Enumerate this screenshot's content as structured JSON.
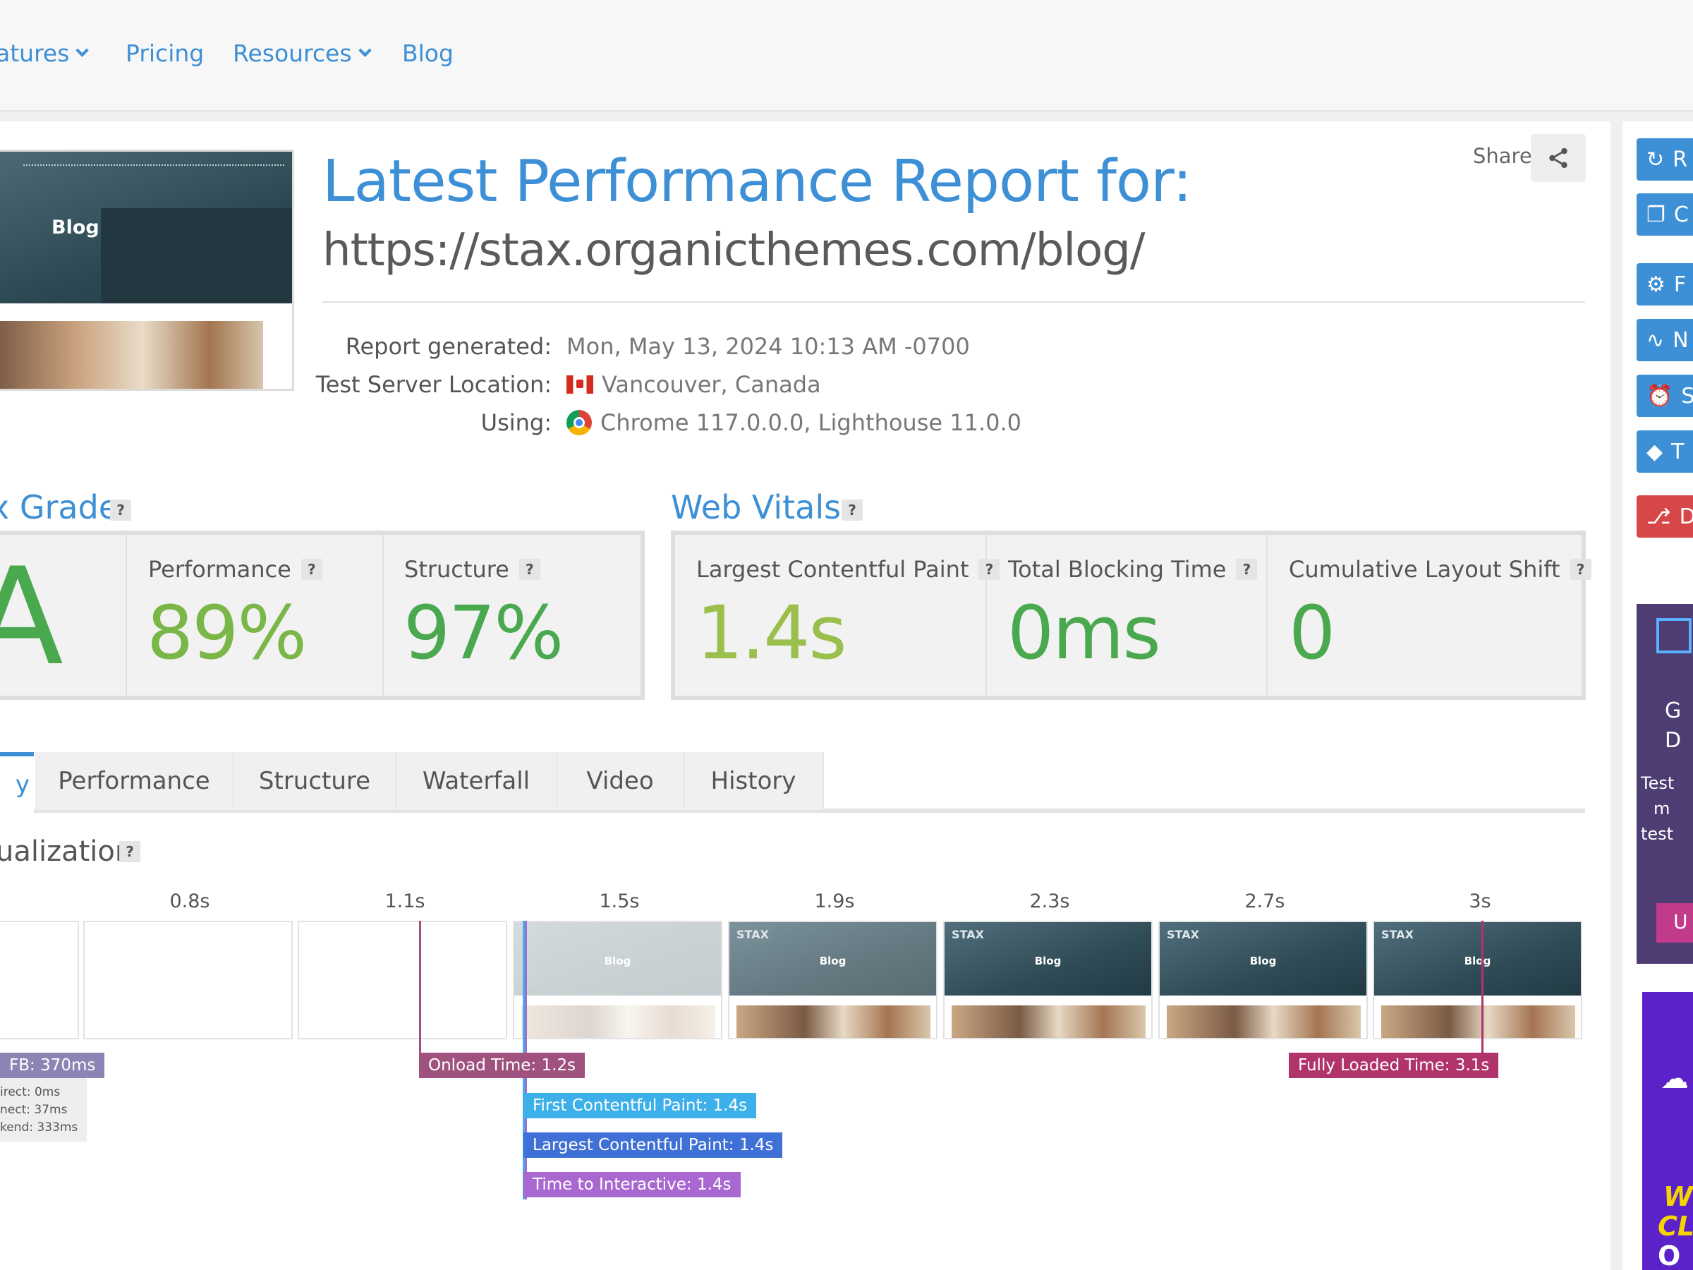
{
  "nav": {
    "items": [
      "atures",
      "Pricing",
      "Resources",
      "Blog"
    ]
  },
  "thumbnail": {
    "hero_text": "Blog"
  },
  "report": {
    "title": "Latest Performance Report for:",
    "url": "https://stax.organicthemes.com/blog/",
    "share_label": "Share",
    "generated_label": "Report generated:",
    "generated_value": "Mon, May 13, 2024 10:13 AM -0700",
    "location_label": "Test Server Location:",
    "location_value": "Vancouver, Canada",
    "using_label": "Using:",
    "using_value": "Chrome 117.0.0.0, Lighthouse 11.0.0"
  },
  "grade": {
    "title": "x Grade",
    "letter": "A",
    "performance_label": "Performance",
    "performance_value": "89%",
    "structure_label": "Structure",
    "structure_value": "97%"
  },
  "web_vitals": {
    "title": "Web Vitals",
    "lcp_label": "Largest Contentful Paint",
    "lcp_value": "1.4s",
    "tbt_label": "Total Blocking Time",
    "tbt_value": "0ms",
    "cls_label": "Cumulative Layout Shift",
    "cls_value": "0"
  },
  "tabs": {
    "active": "y",
    "items": [
      "Performance",
      "Structure",
      "Waterfall",
      "Video",
      "History"
    ]
  },
  "visualization": {
    "title": "ualization",
    "ticks": [
      "0.8s",
      "1.1s",
      "1.5s",
      "1.9s",
      "2.3s",
      "2.7s",
      "3s"
    ],
    "frame_logo": "STAX",
    "frame_text": "Blog",
    "markers": {
      "ttfb": "FB: 370ms",
      "onload": "Onload Time: 1.2s",
      "fcp": "First Contentful Paint: 1.4s",
      "lcp": "Largest Contentful Paint: 1.4s",
      "tti": "Time to Interactive: 1.4s",
      "fully_loaded": "Fully Loaded Time: 3.1s"
    },
    "ttfb_details": [
      "irect: 0ms",
      "nect: 37ms",
      "kend: 333ms"
    ]
  },
  "sidebar": {
    "buttons": [
      "R",
      "C",
      "F",
      "N",
      "S",
      "T",
      "D"
    ],
    "ad1_lines": [
      "G",
      "D",
      "Test",
      "m",
      "test"
    ],
    "ad1_button": "U",
    "ad2_lines": [
      "W",
      "CL",
      "O"
    ]
  },
  "colors": {
    "accent": "#3d8fd6",
    "grade_green": "#4aa84f",
    "perf_green": "#7ab648",
    "lcp_green": "#9bbf4c",
    "ttfb": "#8a85b5",
    "onload": "#a0527f",
    "fcp": "#3db0ea",
    "lcp": "#3f70d6",
    "tti": "#a868d0",
    "fully_loaded": "#b0336b",
    "pdf_red": "#d84747"
  }
}
